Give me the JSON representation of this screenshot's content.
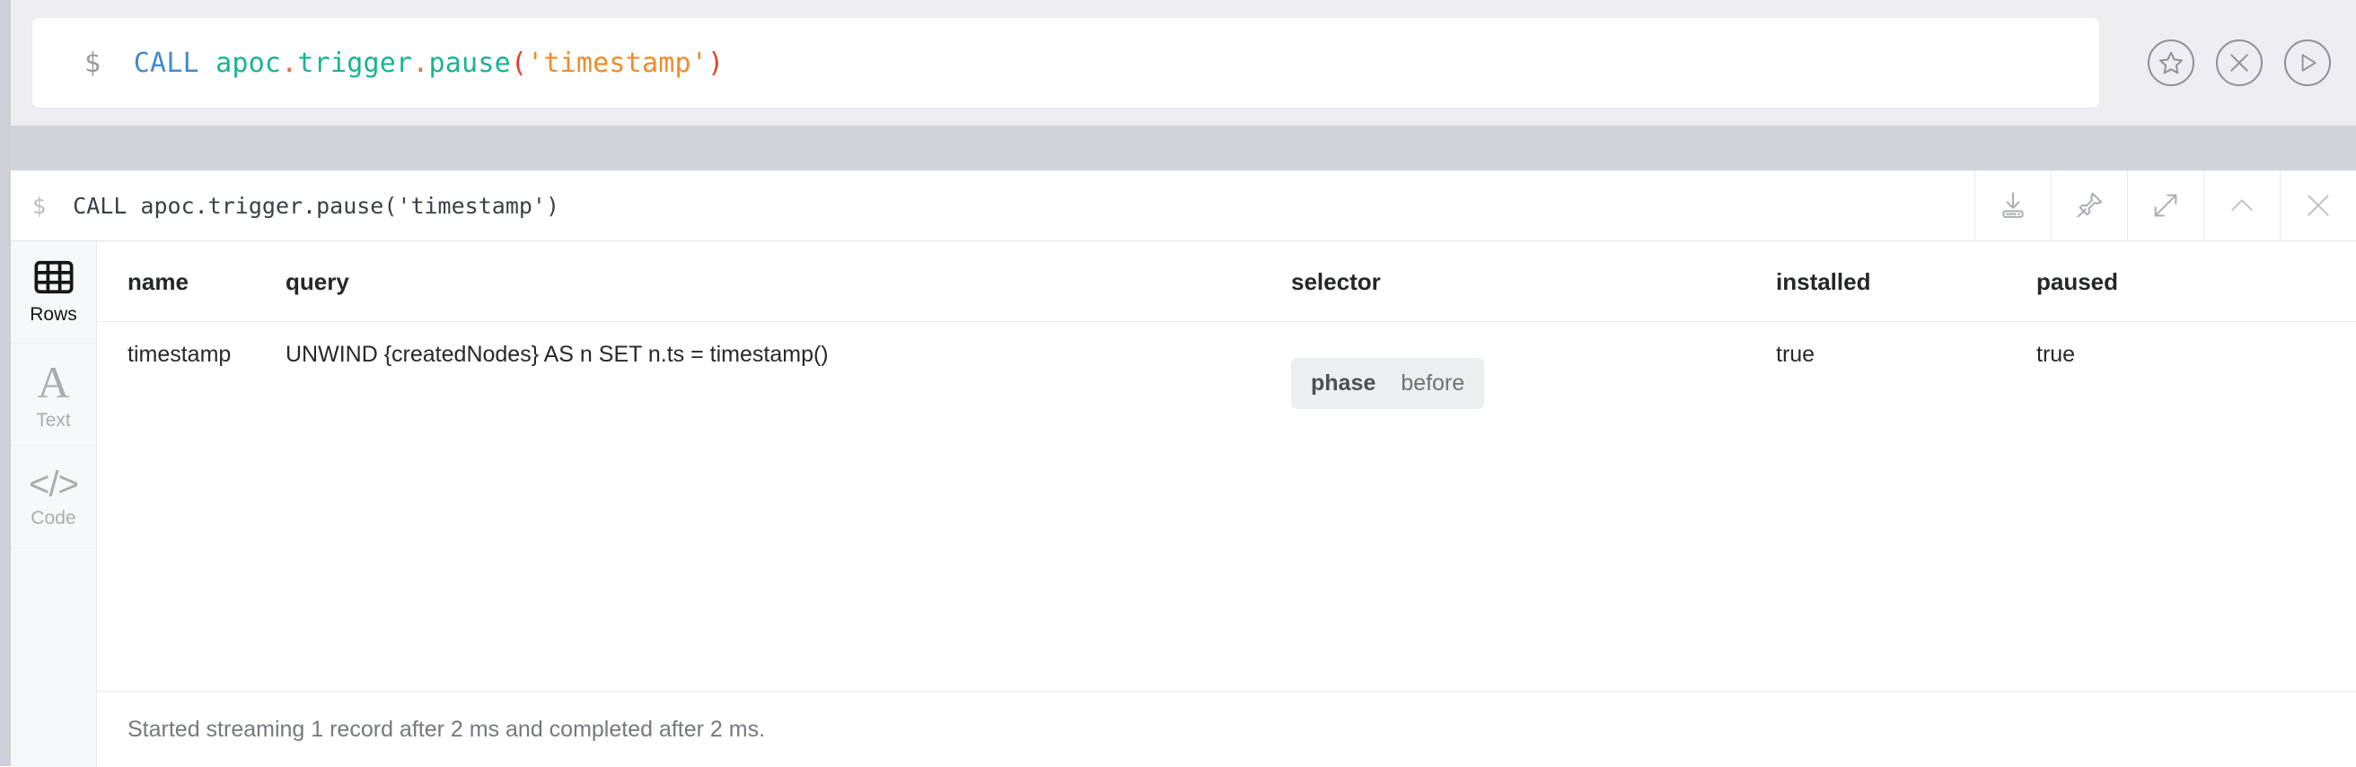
{
  "editor": {
    "prompt": "$",
    "tokens": [
      {
        "text": "CALL",
        "kind": "keyword"
      },
      {
        "text": " ",
        "kind": "space"
      },
      {
        "text": "apoc",
        "kind": "proc"
      },
      {
        "text": ".",
        "kind": "dot"
      },
      {
        "text": "trigger",
        "kind": "proc"
      },
      {
        "text": ".",
        "kind": "dot"
      },
      {
        "text": "pause",
        "kind": "proc"
      },
      {
        "text": "(",
        "kind": "paren"
      },
      {
        "text": "'timestamp'",
        "kind": "string"
      },
      {
        "text": ")",
        "kind": "paren"
      }
    ],
    "plain_text": "CALL apoc.trigger.pause('timestamp')",
    "actions": [
      {
        "name": "favorite-button",
        "icon": "star-icon",
        "label": "Favorite"
      },
      {
        "name": "clear-button",
        "icon": "close-icon",
        "label": "Clear"
      },
      {
        "name": "run-button",
        "icon": "play-icon",
        "label": "Run"
      }
    ]
  },
  "result": {
    "header": {
      "prompt": "$",
      "query": "CALL apoc.trigger.pause('timestamp')"
    },
    "toolbar": [
      {
        "name": "download-button",
        "icon": "download-icon",
        "label": "Download"
      },
      {
        "name": "pin-button",
        "icon": "pin-icon",
        "label": "Pin"
      },
      {
        "name": "fullscreen-button",
        "icon": "expand-icon",
        "label": "Fullscreen"
      },
      {
        "name": "collapse-button",
        "icon": "chevron-up-icon",
        "label": "Collapse"
      },
      {
        "name": "close-button",
        "icon": "close-icon",
        "label": "Close"
      }
    ],
    "view_tabs": [
      {
        "name": "tab-rows",
        "label": "Rows",
        "icon": "table-icon",
        "active": true
      },
      {
        "name": "tab-text",
        "label": "Text",
        "icon": "letter-a-icon",
        "active": false
      },
      {
        "name": "tab-code",
        "label": "Code",
        "icon": "code-brackets-icon",
        "active": false
      }
    ],
    "table": {
      "columns": [
        "name",
        "query",
        "selector",
        "installed",
        "paused"
      ],
      "rows": [
        {
          "name": "timestamp",
          "query": "UNWIND {createdNodes} AS n SET n.ts = timestamp()",
          "selector": {
            "key": "phase",
            "value": "before"
          },
          "installed": "true",
          "paused": "true"
        }
      ]
    },
    "status": "Started streaming 1 record after 2 ms and completed after 2 ms."
  },
  "colors": {
    "editor_background": "#eeeef2",
    "gap_band": "#d0d3d9",
    "left_rail": "#cdd0d6",
    "sidebar": "#f7f8fa",
    "keyword": "#428bca",
    "procedure": "#18b394",
    "string": "#ef8b2c",
    "paren": "#e0402b",
    "chip_background": "#eceef0"
  }
}
